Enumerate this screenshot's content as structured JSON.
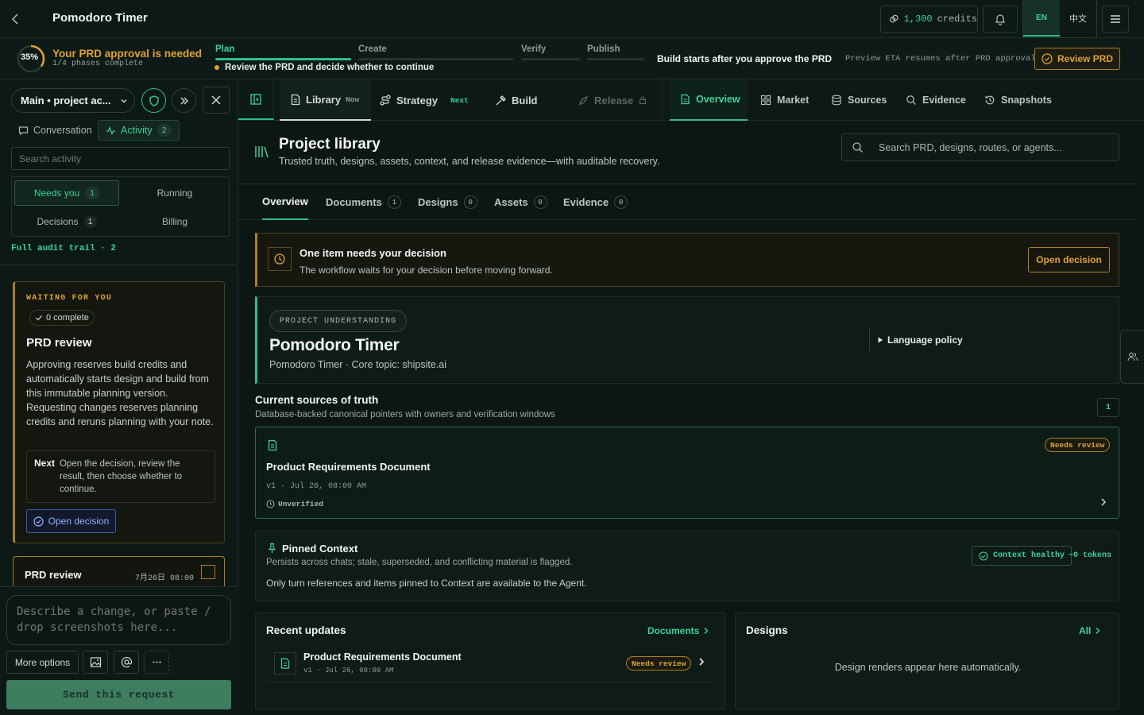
{
  "header": {
    "title": "Pomodoro Timer",
    "credits_value": "1,300",
    "credits_unit": "credits",
    "lang_en": "EN",
    "lang_zh": "中文"
  },
  "phase_bar": {
    "progress_percent": "35%",
    "progress_fraction": 0.35,
    "approval_title": "Your PRD approval is needed",
    "approval_sub": "1/4 phases complete",
    "phases": [
      "Plan",
      "Create",
      "Verify",
      "Publish"
    ],
    "hint": "Review the PRD and decide whether to continue",
    "build_starts": "Build starts after you approve the PRD",
    "eta_note": "Preview ETA resumes after PRD approval",
    "review_button": "Review PRD"
  },
  "sidebar": {
    "project_selector": "Main • project ac...",
    "tabs": {
      "conversation": "Conversation",
      "activity": "Activity",
      "activity_count": "2"
    },
    "search_placeholder": "Search activity",
    "filters": {
      "needs_you": "Needs you",
      "needs_you_count": "1",
      "running": "Running",
      "decisions": "Decisions",
      "decisions_count": "1",
      "billing": "Billing"
    },
    "audit_trail": "Full audit trail · 2",
    "waiting_card": {
      "label": "WAITING FOR YOU",
      "complete": "0 complete",
      "title": "PRD review",
      "body": "Approving reserves build credits and automatically starts design and build from this immutable planning version. Requesting changes reserves planning credits and reruns planning with your note.",
      "next_label": "Next",
      "next_text": "Open the decision, review the result, then choose whether to continue.",
      "button": "Open decision"
    },
    "prd_item": {
      "title": "PRD review",
      "date": "7月26日 08:00"
    },
    "composer": {
      "placeholder": "Describe a change, or paste / drop screenshots here...",
      "more_options": "More options",
      "send": "Send this request"
    }
  },
  "main_nav": {
    "library": "Library",
    "library_tag": "Now",
    "strategy": "Strategy",
    "strategy_tag": "Next",
    "build": "Build",
    "release": "Release",
    "views": [
      "Overview",
      "Market",
      "Sources",
      "Evidence",
      "Snapshots"
    ]
  },
  "library": {
    "title": "Project library",
    "subtitle": "Trusted truth, designs, assets, context, and release evidence—with auditable recovery.",
    "search_placeholder": "Search PRD, designs, routes, or agents...",
    "tabs": [
      {
        "label": "Overview",
        "count": ""
      },
      {
        "label": "Documents",
        "count": "1"
      },
      {
        "label": "Designs",
        "count": "0"
      },
      {
        "label": "Assets",
        "count": "0"
      },
      {
        "label": "Evidence",
        "count": "0"
      }
    ]
  },
  "decision_banner": {
    "title": "One item needs your decision",
    "subtitle": "The workflow waits for your decision before moving forward.",
    "button": "Open decision"
  },
  "understanding": {
    "chip": "PROJECT UNDERSTANDING",
    "title": "Pomodoro Timer",
    "subtitle": "Pomodoro Timer · Core topic: shipsite.ai",
    "language_policy": "Language policy"
  },
  "sources": {
    "title": "Current sources of truth",
    "subtitle": "Database-backed canonical pointers with owners and verification windows",
    "count": "1",
    "card": {
      "title": "Product Requirements Document",
      "meta": "v1 · Jul 26, 08:00 AM",
      "status": "Unverified",
      "badge": "Needs review"
    }
  },
  "pinned": {
    "title": "Pinned Context",
    "subtitle": "Persists across chats; stale, superseded, and conflicting material is flagged.",
    "note": "Only turn references and items pinned to Context are available to the Agent.",
    "health": "Context healthy",
    "tokens": "~0 tokens"
  },
  "recent": {
    "title": "Recent updates",
    "link": "Documents",
    "item": {
      "title": "Product Requirements Document",
      "meta": "v1 · Jul 26, 08:00 AM",
      "badge": "Needs review"
    }
  },
  "designs": {
    "title": "Designs",
    "link": "All",
    "empty": "Design renders appear here automatically."
  },
  "colors": {
    "accent": "#39d39a",
    "warning": "#e0a233",
    "background": "#0c1714",
    "info": "#8fb3ff"
  }
}
